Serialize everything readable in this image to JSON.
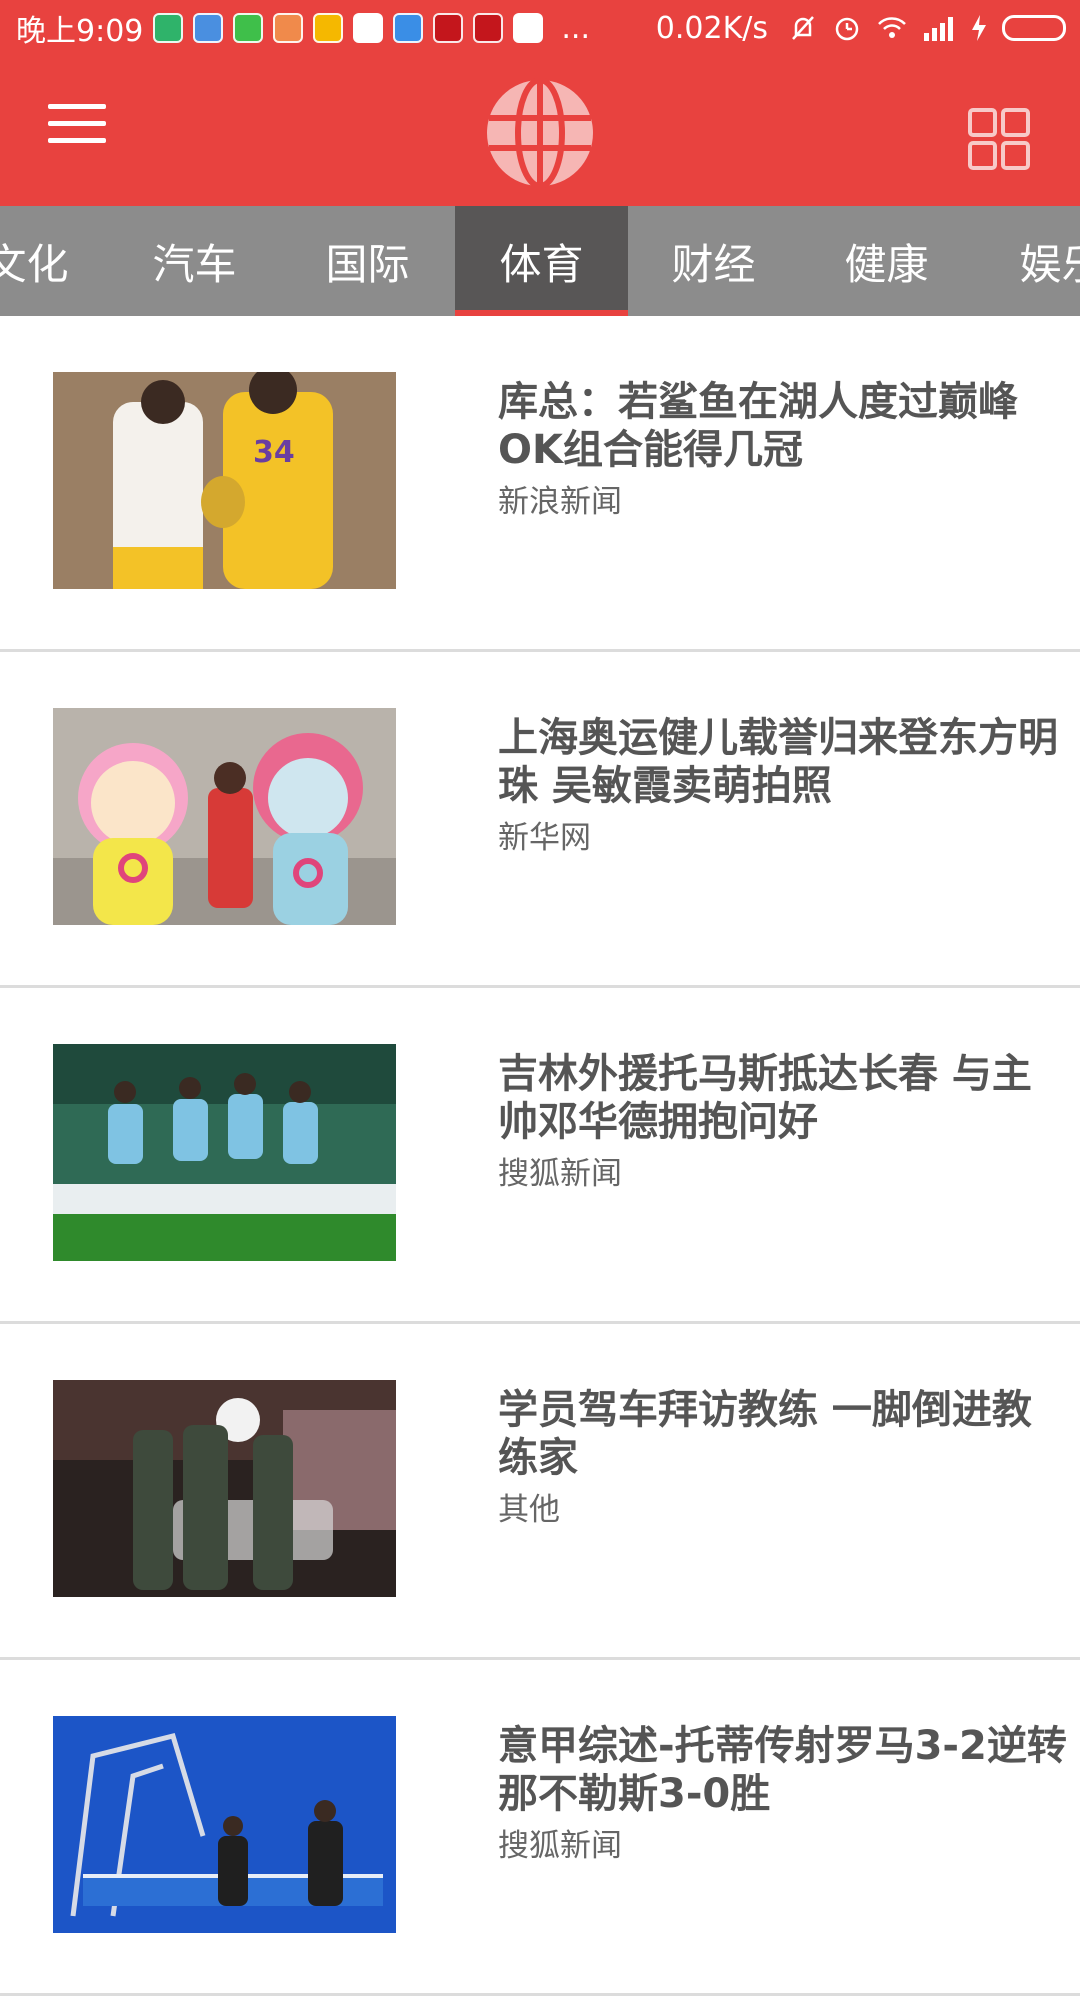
{
  "status_bar": {
    "time": "晚上9:09",
    "network_speed": "0.02K/s",
    "more": "...",
    "icons": [
      "app-icon-1",
      "app-icon-2",
      "app-icon-3",
      "app-icon-4",
      "app-icon-5",
      "app-icon-6",
      "app-icon-7",
      "app-icon-8",
      "app-icon-9",
      "app-icon-10"
    ]
  },
  "app_bar": {
    "menu_icon": "hamburger-menu-icon",
    "logo_icon": "globe-logo-icon",
    "grid_icon": "grid-icon",
    "accent_color": "#e8423f"
  },
  "tabs": [
    {
      "label": "文化"
    },
    {
      "label": "汽车"
    },
    {
      "label": "国际"
    },
    {
      "label": "体育",
      "active": true
    },
    {
      "label": "财经"
    },
    {
      "label": "健康"
    },
    {
      "label": "娱乐"
    }
  ],
  "news": [
    {
      "title": "库总：若鲨鱼在湖人度过巅峰OK组合能得几冠",
      "source": "新浪新闻",
      "image": "basketball-players-photo"
    },
    {
      "title": "上海奥运健儿载誉归来登东方明珠 吴敏霞卖萌拍照",
      "source": "新华网",
      "image": "mascots-photo"
    },
    {
      "title": "吉林外援托马斯抵达长春 与主帅邓华德拥抱问好",
      "source": "搜狐新闻",
      "image": "soccer-players-photo"
    },
    {
      "title": "学员驾车拜访教练 一脚倒进教练家",
      "source": "其他",
      "image": "night-street-photo"
    },
    {
      "title": "意甲综述-托蒂传射罗马3-2逆转那不勒斯3-0胜",
      "source": "搜狐新闻",
      "image": "table-tennis-robot-photo"
    }
  ]
}
